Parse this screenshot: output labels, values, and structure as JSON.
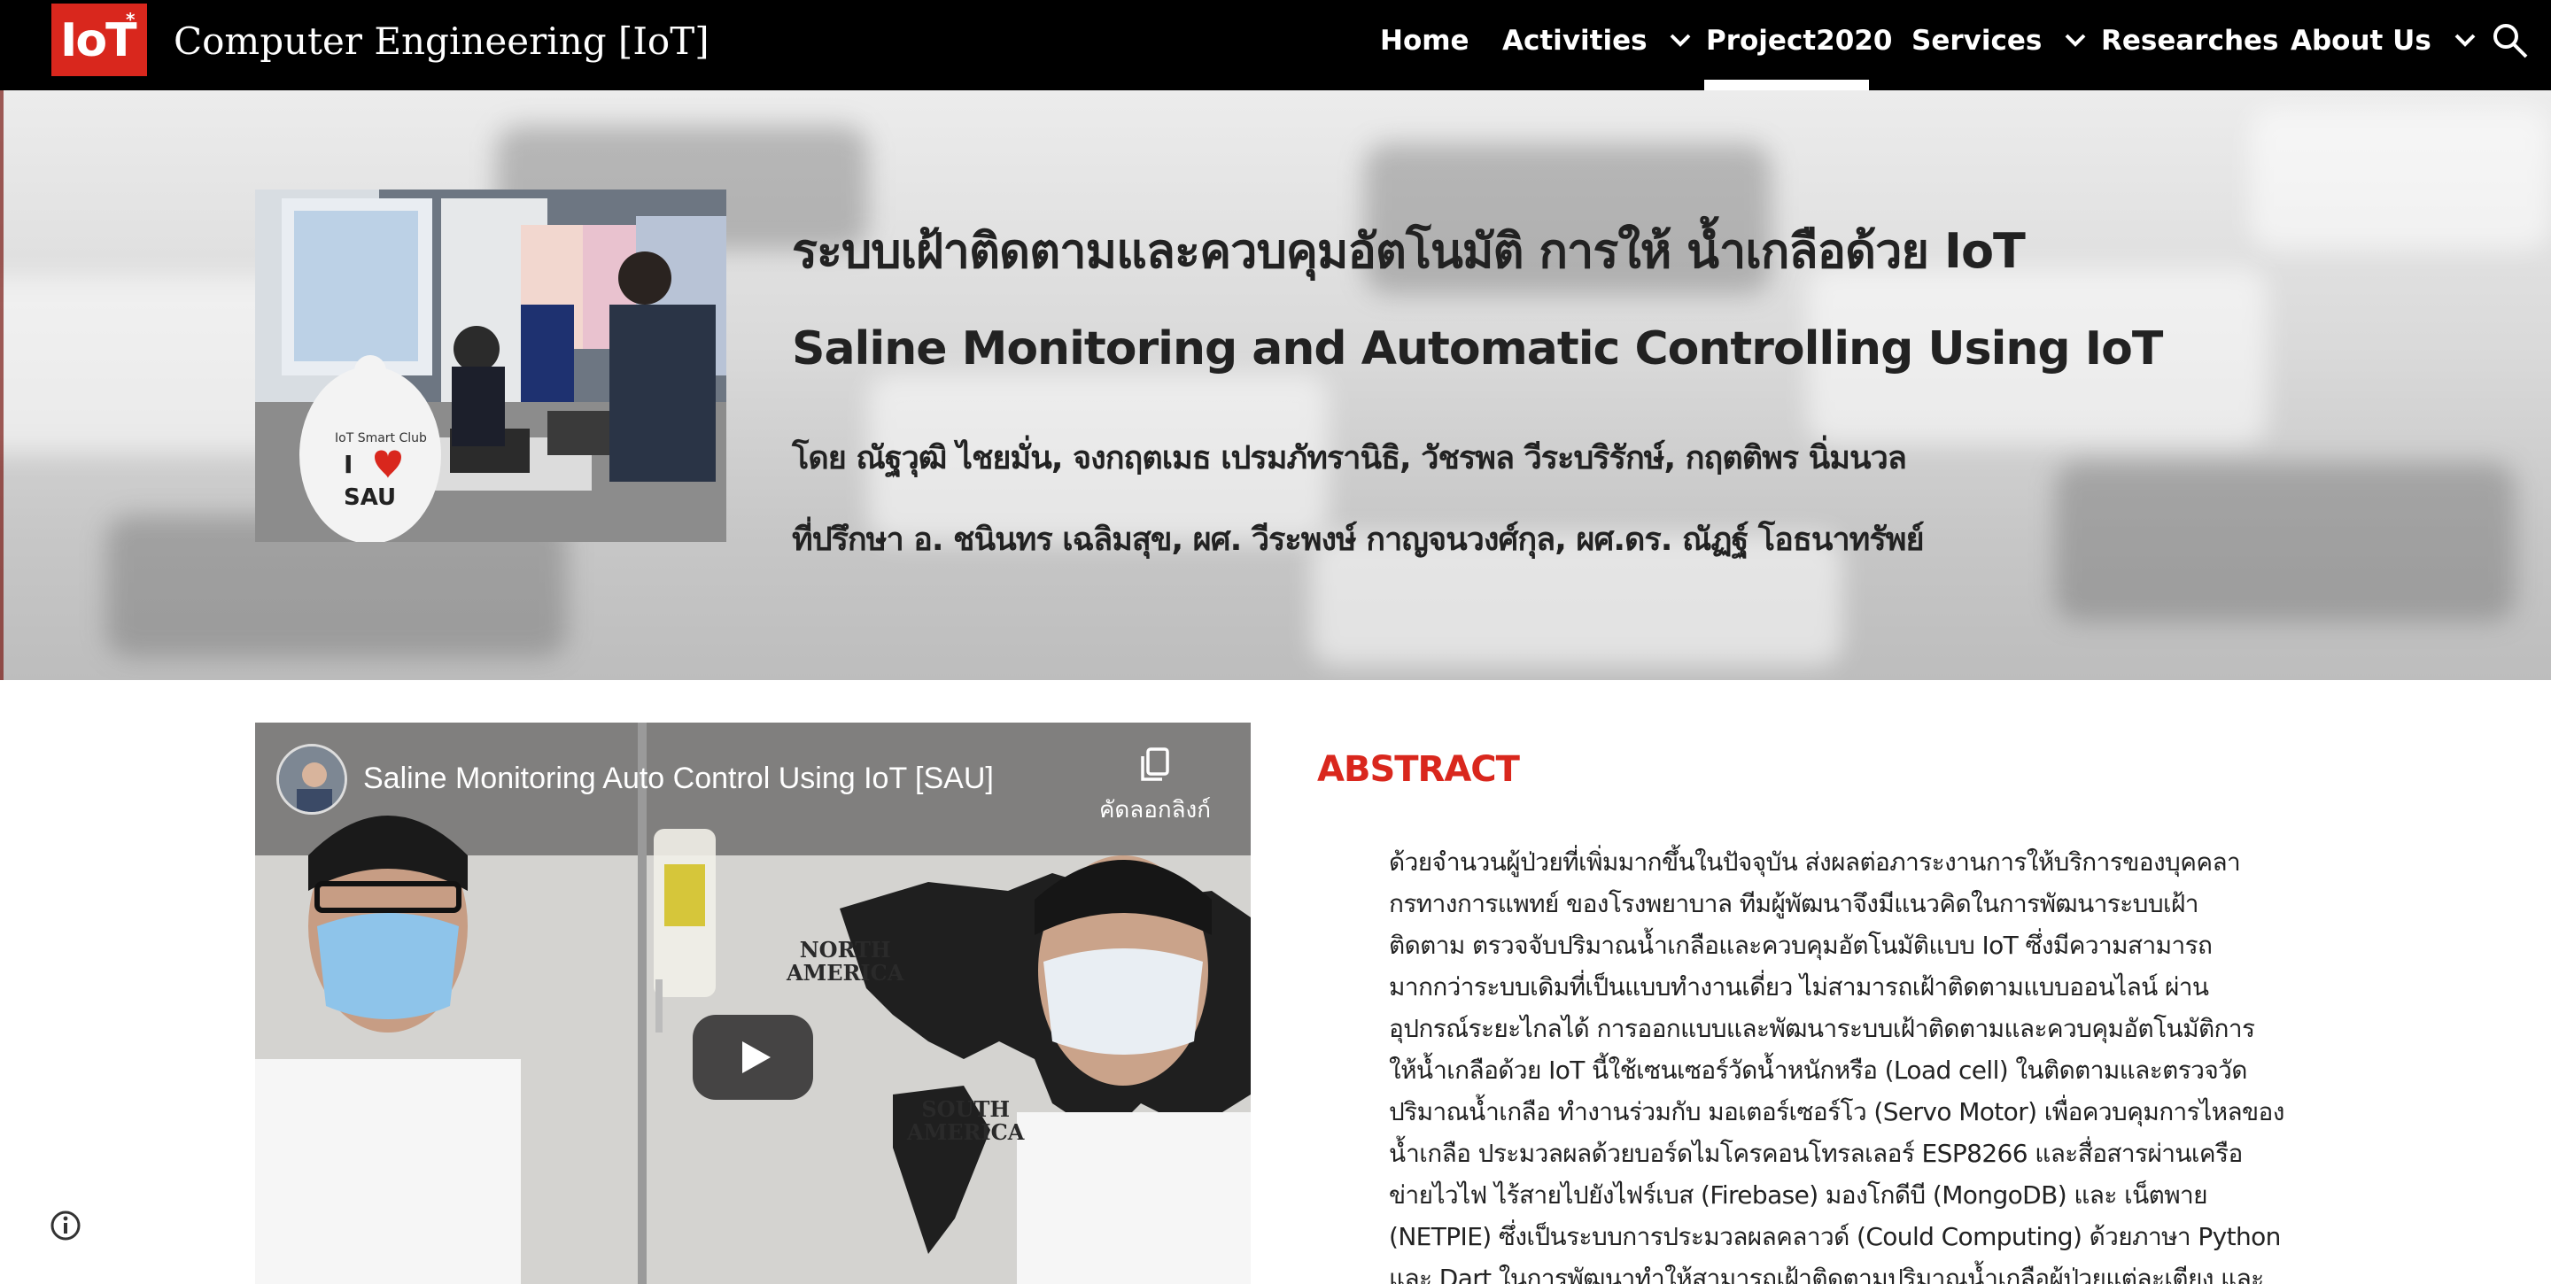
{
  "header": {
    "logo_text": "IoT",
    "logo_mark": "*",
    "site_title": "Computer Engineering [IoT]",
    "nav": [
      {
        "label": "Home",
        "has_dropdown": false
      },
      {
        "label": "Activities",
        "has_dropdown": true
      },
      {
        "label": "Project2020",
        "has_dropdown": false,
        "active": true
      },
      {
        "label": "Services",
        "has_dropdown": true
      },
      {
        "label": "Researches",
        "has_dropdown": false
      },
      {
        "label": "About Us",
        "has_dropdown": true
      }
    ],
    "search_icon": "search-icon"
  },
  "hero": {
    "title_th": "ระบบเฝ้าติดตามและควบคุมอัตโนมัติ การให้ น้ำเกลือด้วย IoT",
    "title_en": "Saline Monitoring and Automatic Controlling Using IoT",
    "authors": "โดย ณัฐวุฒิ ไชยมั่น, จงกฤตเมธ เปรมภัทรานิธิ, วัชรพล วีระบริรักษ์, กฤตติพร นิ่มนวล",
    "advisors": "ที่ปรึกษา อ. ชนินทร เฉลิมสุข, ผศ. วีระพงษ์ กาญจนวงศ์กุล, ผศ.ดร. ณัฏฐ์ โอธนาทรัพย์",
    "photo_shirt_line1": "IoT Smart Club",
    "photo_shirt_line2": "I",
    "photo_shirt_line3": "SAU"
  },
  "video": {
    "title": "Saline Monitoring Auto Control Using IoT [SAU]",
    "copy_link_label": "คัดลอกลิงก์",
    "map_label_north": "NORTH\nAMERICA",
    "map_label_south": "SOUTH\nAMERICA"
  },
  "abstract": {
    "heading": "ABSTRACT",
    "lines": [
      "ด้วยจำนวนผู้ป่วยที่เพิ่มมากขึ้นในปัจจุบัน ส่งผลต่อภาระงานการให้บริการของบุคคลา",
      "กรทางการแพทย์ ของโรงพยาบาล ทีมผู้พัฒนาจึงมีแนวคิดในการพัฒนาระบบเฝ้า",
      "ติดตาม ตรวจจับปริมาณน้ำเกลือและควบคุมอัตโนมัติแบบ IoT ซึ่งมีความสามารถ",
      "มากกว่าระบบเดิมที่เป็นแบบทำงานเดี่ยว ไม่สามารถเฝ้าติดตามแบบออนไลน์ ผ่าน",
      "อุปกรณ์ระยะไกลได้ การออกแบบและพัฒนาระบบเฝ้าติดตามและควบคุมอัตโนมัติการ",
      "ให้น้ำเกลือด้วย IoT นี้ใช้เซนเซอร์วัดน้ำหนักหรือ (Load cell) ในติดตามและตรวจวัด",
      "ปริมาณน้ำเกลือ ทำงานร่วมกับ มอเตอร์เซอร์โว (Servo Motor) เพื่อควบคุมการไหลของ",
      "น้ำเกลือ ประมวลผลด้วยบอร์ดไมโครคอนโทรลเลอร์ ESP8266 และสื่อสารผ่านเครือ",
      "ข่ายไวไฟ ไร้สายไปยังไฟร์เบส (Firebase) มองโกดีบี (MongoDB) และ เน็ตพาย",
      "(NETPIE) ซึ่งเป็นระบบการประมวลผลคลาวด์ (Could Computing) ด้วยภาษา Python",
      "และ Dart ในการพัฒนาทำให้สามารถเฝ้าติดตามปริมาณน้ำเกลือผู้ป่วยแต่ละเตียง และ"
    ]
  },
  "colors": {
    "accent": "#d9271d",
    "header_bg": "#000000",
    "text": "#212121"
  }
}
